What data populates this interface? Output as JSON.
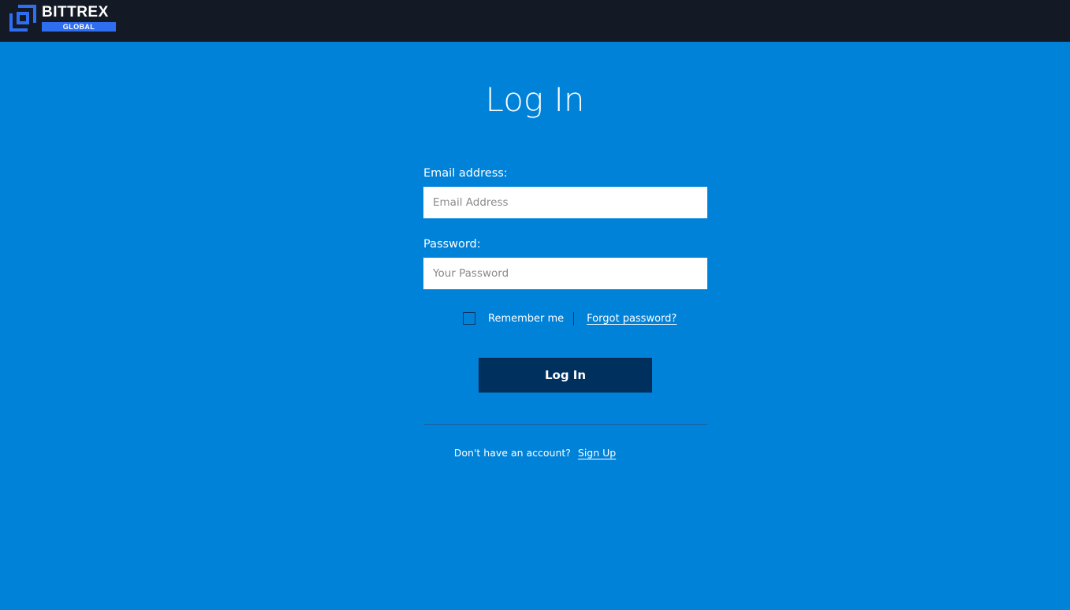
{
  "header": {
    "logo_word": "BITTREX",
    "logo_badge": "GLOBAL",
    "logo_icon": "bittrex-logo-icon"
  },
  "login": {
    "title": "Log In",
    "email_label": "Email address:",
    "email_value": "",
    "email_placeholder": "Email Address",
    "password_label": "Password:",
    "password_value": "",
    "password_placeholder": "Your Password",
    "remember_label": "Remember me",
    "remember_checked": false,
    "forgot_link": "Forgot password?",
    "submit_label": "Log In"
  },
  "signup": {
    "prompt": "Don't have an account?",
    "link": "Sign Up"
  },
  "colors": {
    "background": "#0082d9",
    "topbar": "#131a26",
    "button": "#00305e",
    "logo_accent": "#2f6ef0"
  }
}
